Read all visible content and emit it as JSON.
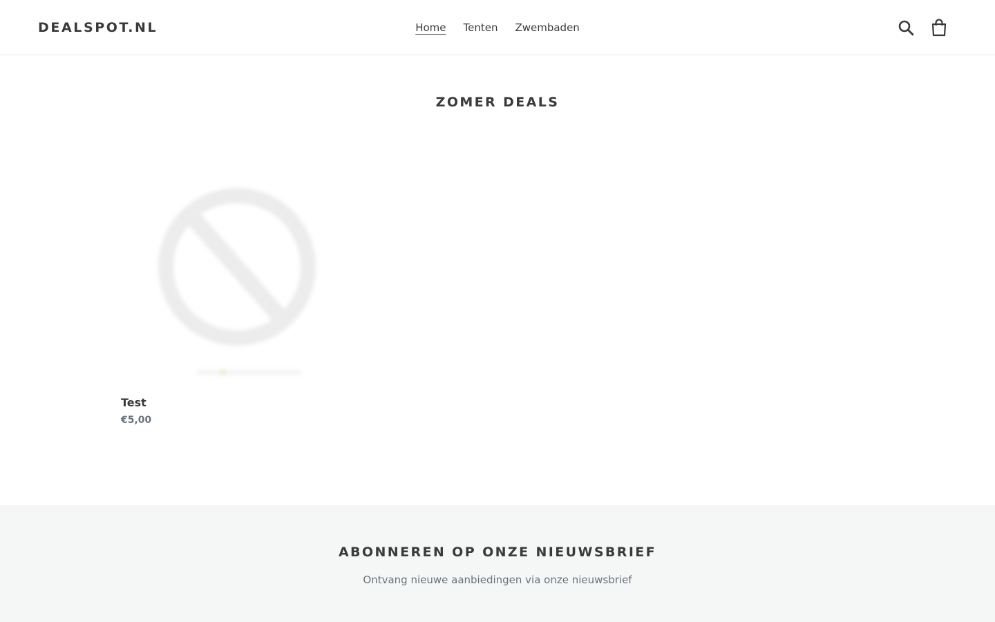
{
  "header": {
    "logo": "DEALSPOT.NL",
    "nav": [
      {
        "label": "Home",
        "active": true
      },
      {
        "label": "Tenten",
        "active": false
      },
      {
        "label": "Zwembaden",
        "active": false
      }
    ],
    "icons": [
      "search-icon",
      "cart-icon"
    ]
  },
  "main": {
    "title": "ZOMER DEALS",
    "products": [
      {
        "title": "Test",
        "price": "€5,00",
        "image_icon": "no-image-placeholder-icon"
      }
    ]
  },
  "newsletter": {
    "title": "ABONNEREN OP ONZE NIEUWSBRIEF",
    "text": "Ontvang nieuwe aanbiedingen via onze nieuwsbrief"
  },
  "colors": {
    "text": "#3a3a3a",
    "muted": "#69727b",
    "footer_bg": "#f5f6f6",
    "border": "#e8e9eb"
  }
}
